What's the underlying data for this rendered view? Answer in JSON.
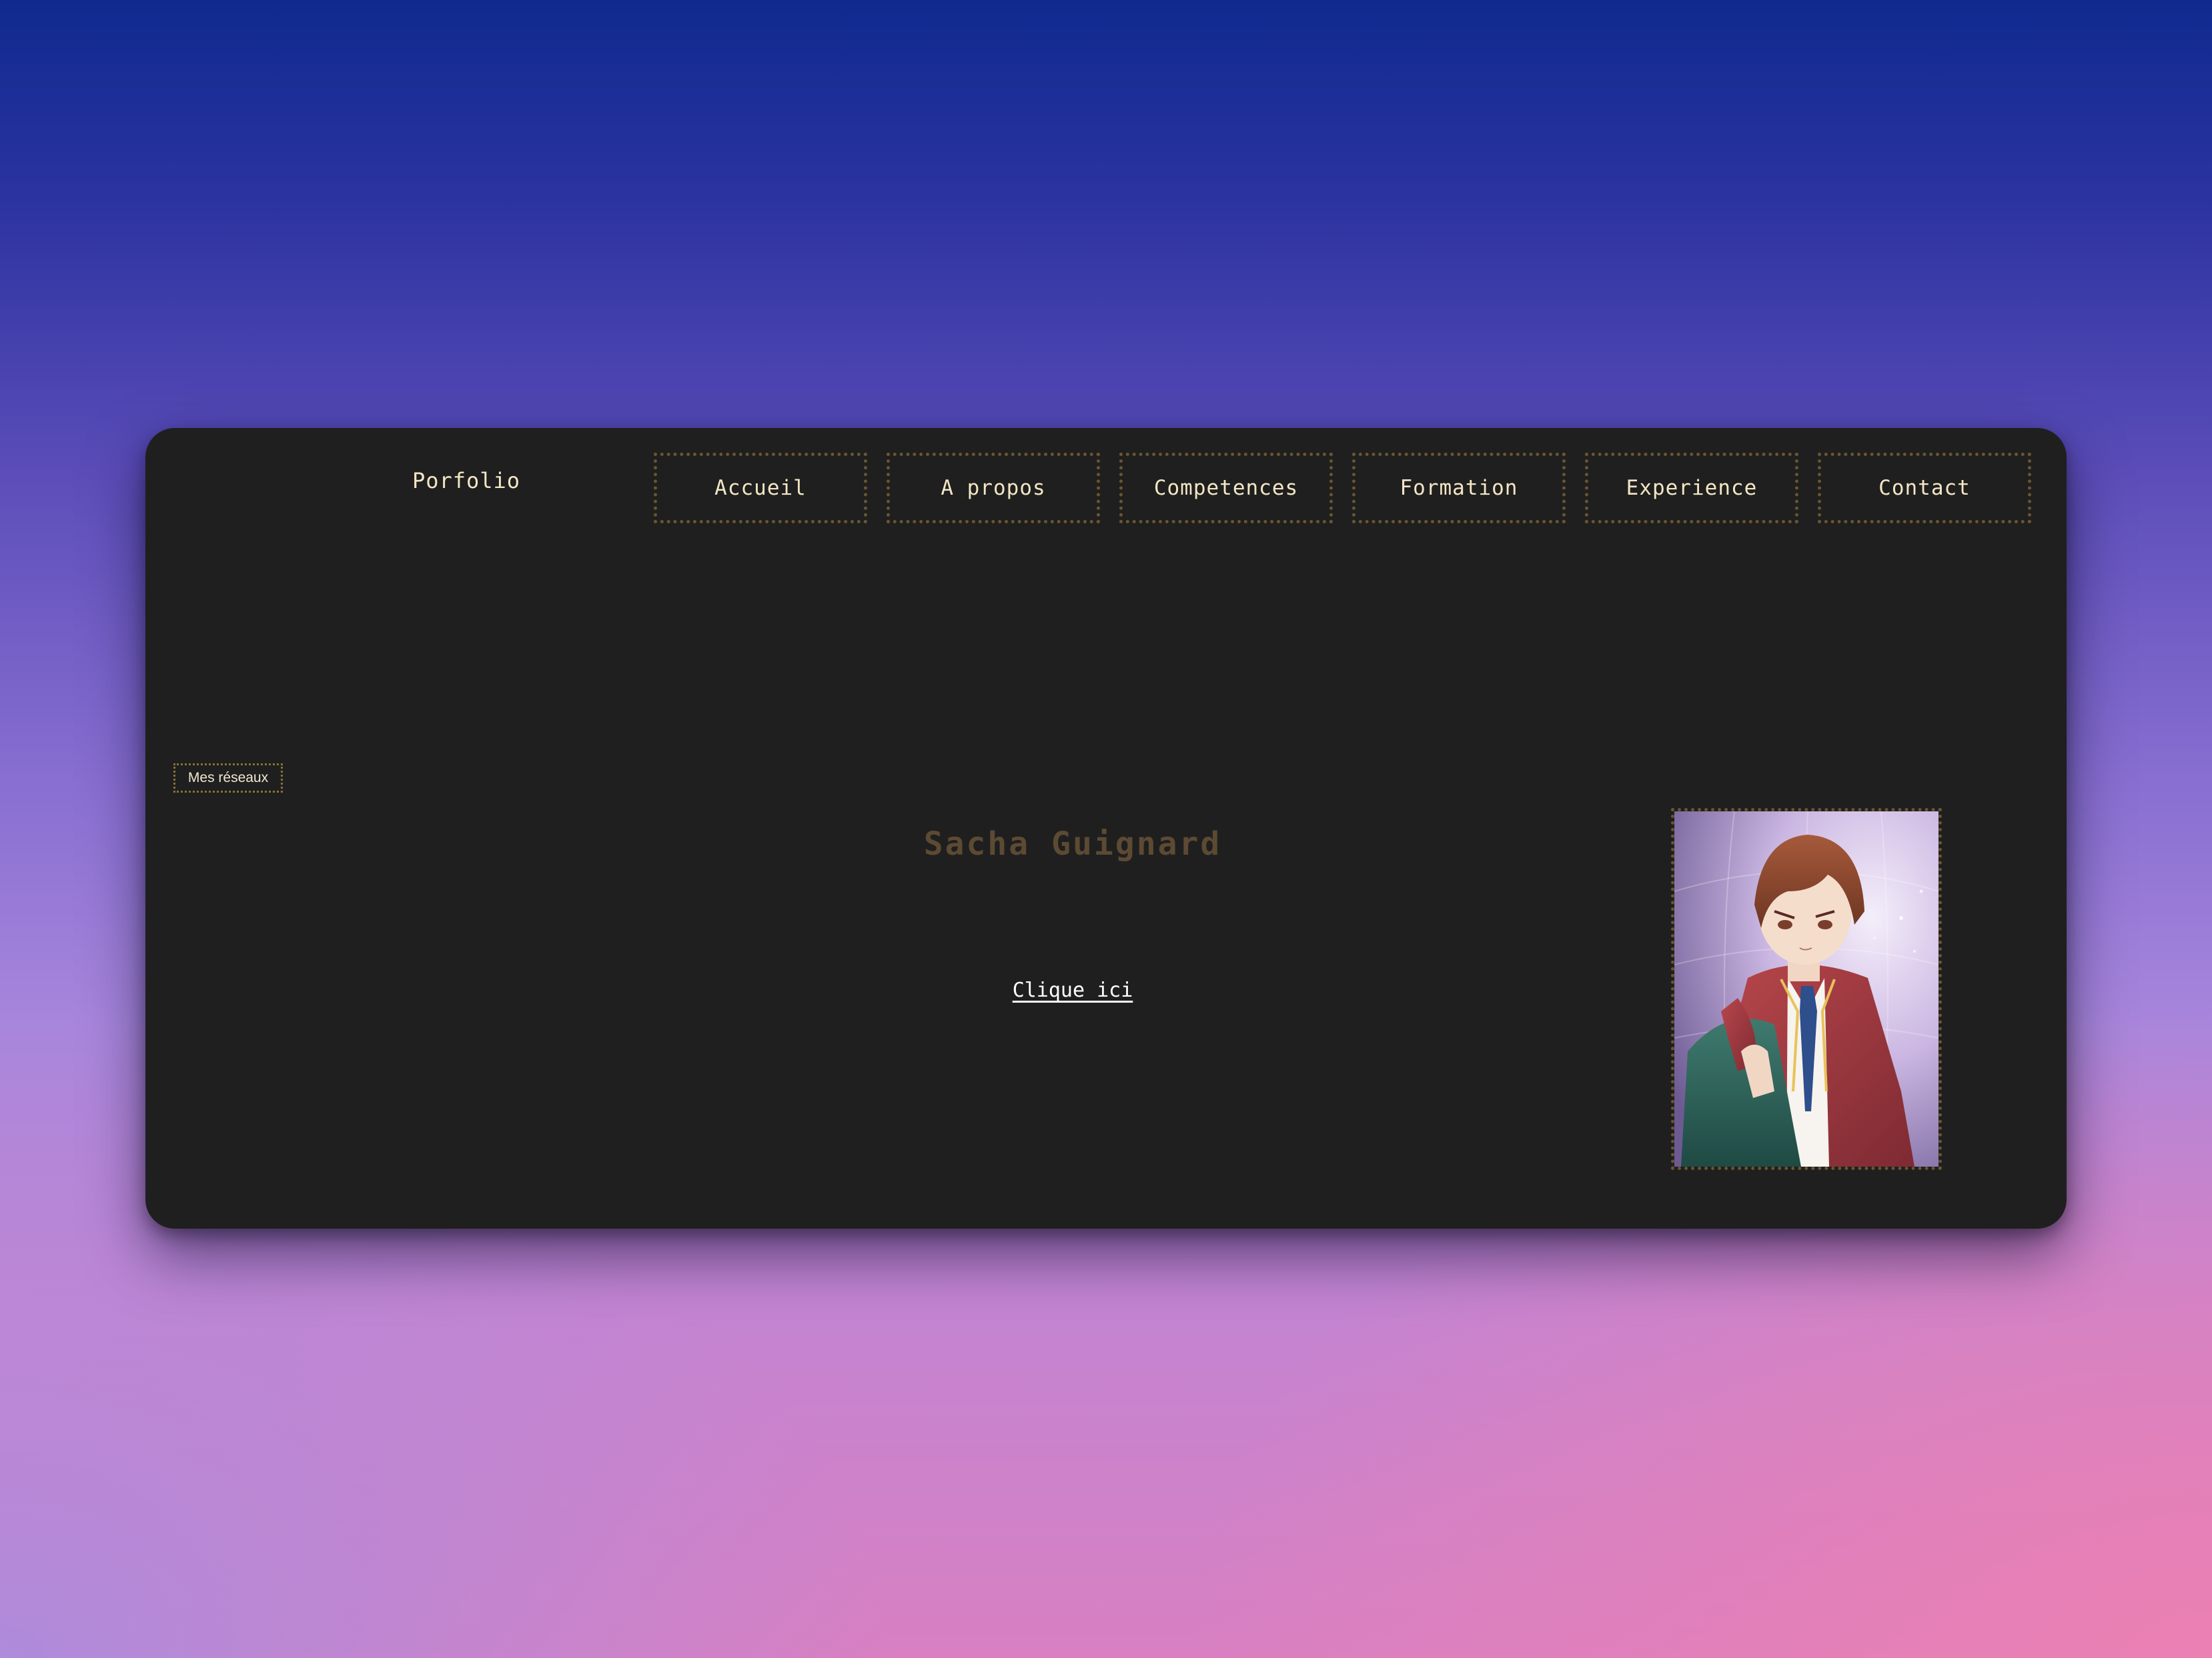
{
  "header": {
    "brand": "Porfolio"
  },
  "nav": {
    "items": [
      {
        "label": "Accueil"
      },
      {
        "label": "A propos"
      },
      {
        "label": "Competences"
      },
      {
        "label": "Formation"
      },
      {
        "label": "Experience"
      },
      {
        "label": "Contact"
      }
    ]
  },
  "sidebar": {
    "socials_label": "Mes réseaux"
  },
  "hero": {
    "name": "Sacha Guignard",
    "cta_label": "Clique ici"
  },
  "colors": {
    "window_bg": "#1f1f1f",
    "border_gold": "#6a5530",
    "text_cream": "#f3e6c4",
    "name_brown": "#5c4a33"
  }
}
